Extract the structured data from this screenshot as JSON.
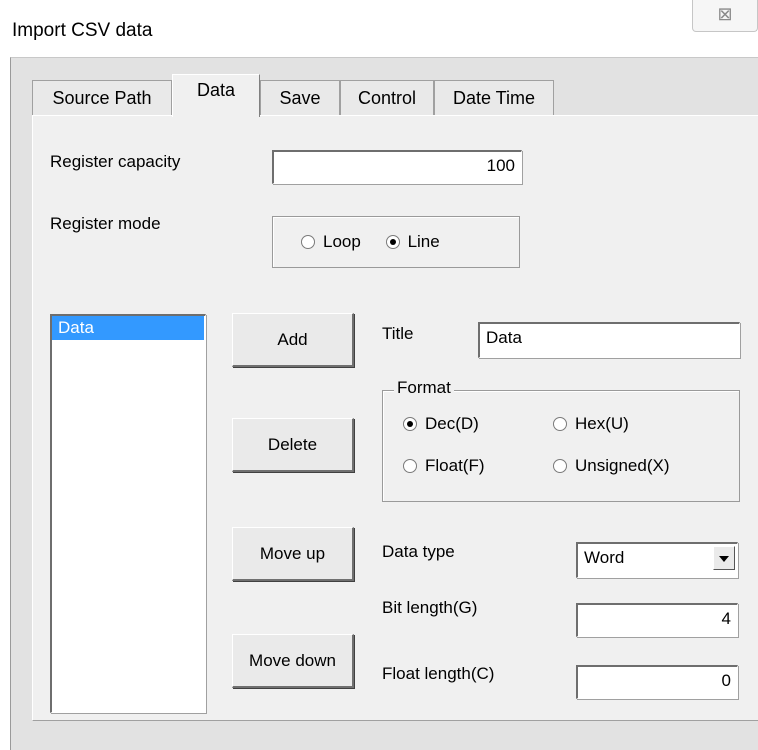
{
  "window": {
    "title": "Import CSV data",
    "close_glyph": "⊠"
  },
  "tabs": [
    {
      "label": "Source Path",
      "active": false
    },
    {
      "label": "Data",
      "active": true
    },
    {
      "label": "Save",
      "active": false
    },
    {
      "label": "Control",
      "active": false
    },
    {
      "label": "Date Time",
      "active": false
    }
  ],
  "register": {
    "capacity_label": "Register capacity",
    "capacity_value": "100",
    "mode_label": "Register mode",
    "mode_options": [
      {
        "label": "Loop",
        "checked": false
      },
      {
        "label": "Line",
        "checked": true
      }
    ]
  },
  "data_list": {
    "items": [
      {
        "label": "Data",
        "selected": true
      }
    ]
  },
  "buttons": {
    "add": "Add",
    "delete": "Delete",
    "move_up": "Move up",
    "move_down": "Move down"
  },
  "title_field": {
    "label": "Title",
    "value": "Data"
  },
  "format": {
    "legend": "Format",
    "options": [
      {
        "label": "Dec(D)",
        "checked": true
      },
      {
        "label": "Hex(U)",
        "checked": false
      },
      {
        "label": "Float(F)",
        "checked": false
      },
      {
        "label": "Unsigned(X)",
        "checked": false
      }
    ]
  },
  "data_type": {
    "label": "Data type",
    "value": "Word"
  },
  "bit_length": {
    "label": "Bit length(G)",
    "value": "4"
  },
  "float_length": {
    "label": "Float length(C)",
    "value": "0"
  }
}
